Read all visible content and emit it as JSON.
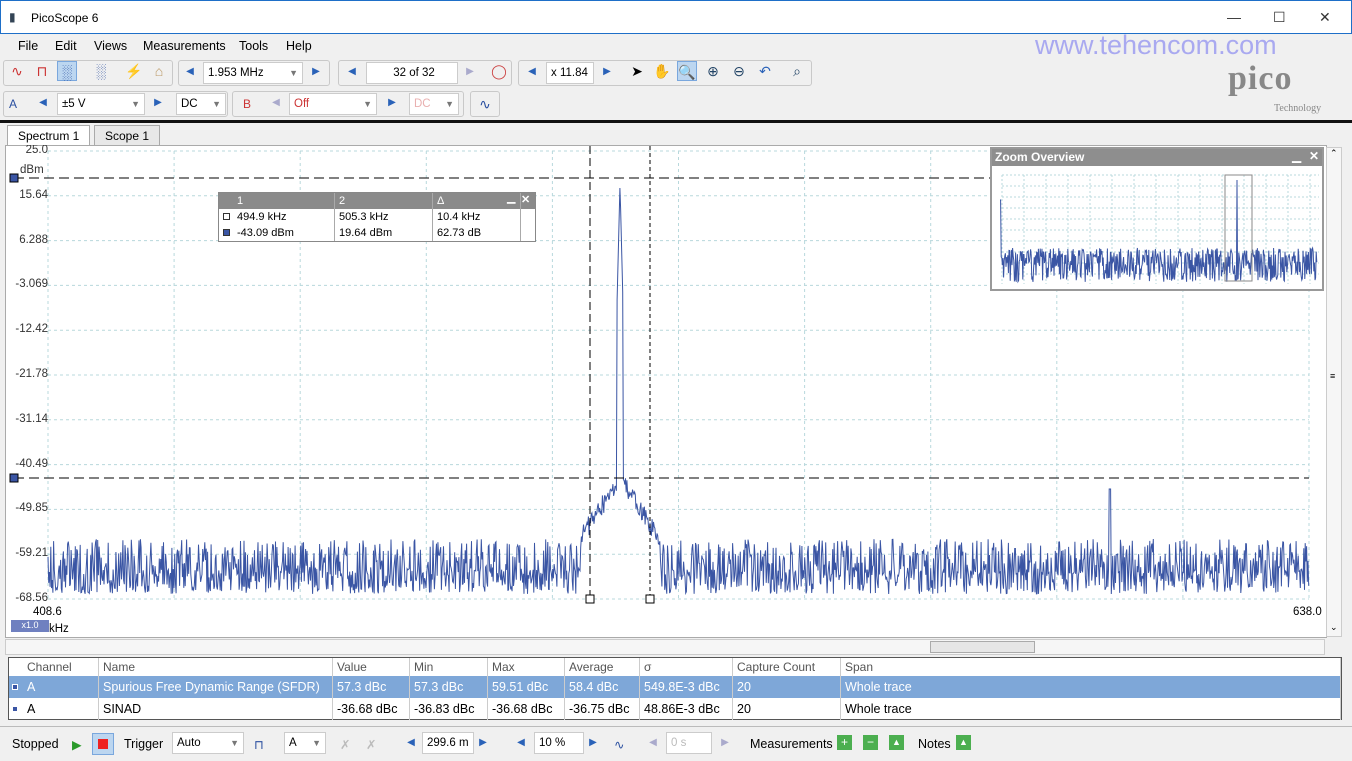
{
  "window": {
    "title": "PicoScope 6",
    "watermark": "www.tehencom.com",
    "logo": "pico",
    "logo_sub": "Technology"
  },
  "menu": [
    "File",
    "Edit",
    "Views",
    "Measurements",
    "Tools",
    "Help"
  ],
  "toolbar": {
    "span": "1.953 MHz",
    "capture": "32 of 32",
    "zoom": "x 11.84"
  },
  "channel_a": {
    "label": "A",
    "range": "±5 V",
    "coupling": "DC"
  },
  "channel_b": {
    "label": "B",
    "range": "Off",
    "coupling": "DC"
  },
  "tabs": [
    "Spectrum 1",
    "Scope 1"
  ],
  "plot": {
    "y_unit": "dBm",
    "y_ticks": [
      "25.0",
      "15.64",
      "6.288",
      "-3.069",
      "-12.42",
      "-21.78",
      "-31.14",
      "-40.49",
      "-49.85",
      "-59.21",
      "-68.56"
    ],
    "x_start": "408.6",
    "x_end": "638.0",
    "x_unit": "kHz",
    "x_zoom": "x1.0",
    "trace_color": "#3a55a4"
  },
  "rulers": {
    "headers": [
      "1",
      "2",
      "Δ"
    ],
    "rows": [
      [
        "494.9 kHz",
        "505.3 kHz",
        "10.4 kHz"
      ],
      [
        "-43.09 dBm",
        "19.64 dBm",
        "62.73 dB"
      ]
    ]
  },
  "zoom_overview": {
    "title": "Zoom Overview"
  },
  "measurements": {
    "headers": [
      "Channel",
      "Name",
      "Value",
      "Min",
      "Max",
      "Average",
      "σ",
      "Capture Count",
      "Span"
    ],
    "rows": [
      [
        "A",
        "Spurious Free Dynamic Range (SFDR)",
        "57.3 dBc",
        "57.3 dBc",
        "59.51 dBc",
        "58.4 dBc",
        "549.8E-3 dBc",
        "20",
        "Whole trace"
      ],
      [
        "A",
        "SINAD",
        "-36.68 dBc",
        "-36.83 dBc",
        "-36.68 dBc",
        "-36.75 dBc",
        "48.86E-3 dBc",
        "20",
        "Whole trace"
      ]
    ]
  },
  "status": {
    "state": "Stopped",
    "trigger_label": "Trigger",
    "trigger_mode": "Auto",
    "trigger_channel": "A",
    "timebase": "299.6 m",
    "pretrigger": "10 %",
    "delay": "0 s",
    "measurements_label": "Measurements",
    "notes_label": "Notes"
  }
}
